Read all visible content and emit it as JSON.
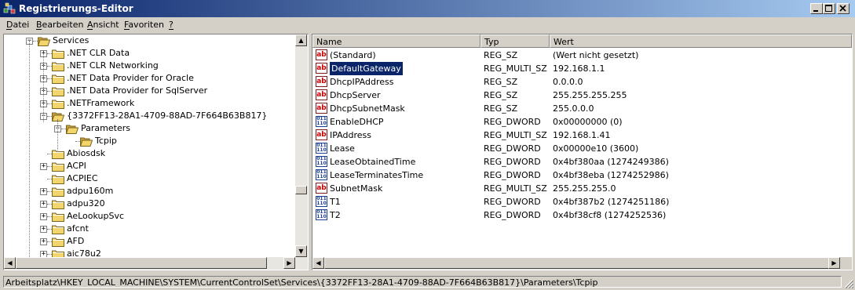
{
  "window": {
    "title": "Registrierungs-Editor",
    "controls": [
      "minimize-icon",
      "maximize-icon",
      "close-icon"
    ]
  },
  "menu": [
    {
      "label": "Datei",
      "accel": "D"
    },
    {
      "label": "Bearbeiten",
      "accel": "B"
    },
    {
      "label": "Ansicht",
      "accel": "A"
    },
    {
      "label": "Favoriten",
      "accel": "F"
    },
    {
      "label": "?",
      "accel": "?"
    }
  ],
  "tree": {
    "items": [
      {
        "label": "Services",
        "expander": "−",
        "icon": "folder-open-icon"
      },
      {
        "label": ".NET CLR Data",
        "expander": "+",
        "icon": "folder-icon"
      },
      {
        "label": ".NET CLR Networking",
        "expander": "+",
        "icon": "folder-icon"
      },
      {
        "label": ".NET Data Provider for Oracle",
        "expander": "+",
        "icon": "folder-icon"
      },
      {
        "label": ".NET Data Provider for SqlServer",
        "expander": "+",
        "icon": "folder-icon"
      },
      {
        "label": ".NETFramework",
        "expander": "+",
        "icon": "folder-icon"
      },
      {
        "label": "{3372FF13-28A1-4709-88AD-7F664B63B817}",
        "expander": "−",
        "icon": "folder-open-icon"
      },
      {
        "label": "Parameters",
        "expander": "−",
        "icon": "folder-open-icon"
      },
      {
        "label": "Tcpip",
        "expander": "",
        "icon": "folder-open-icon"
      },
      {
        "label": "Abiosdsk",
        "expander": "",
        "icon": "folder-icon"
      },
      {
        "label": "ACPI",
        "expander": "+",
        "icon": "folder-icon"
      },
      {
        "label": "ACPIEC",
        "expander": "",
        "icon": "folder-icon"
      },
      {
        "label": "adpu160m",
        "expander": "+",
        "icon": "folder-icon"
      },
      {
        "label": "adpu320",
        "expander": "+",
        "icon": "folder-icon"
      },
      {
        "label": "AeLookupSvc",
        "expander": "+",
        "icon": "folder-icon"
      },
      {
        "label": "afcnt",
        "expander": "+",
        "icon": "folder-icon"
      },
      {
        "label": "AFD",
        "expander": "+",
        "icon": "folder-icon"
      },
      {
        "label": "aic78u2",
        "expander": "+",
        "icon": "folder-icon"
      }
    ]
  },
  "list": {
    "columns": [
      "Name",
      "Typ",
      "Wert"
    ],
    "rows": [
      {
        "name": "(Standard)",
        "type": "REG_SZ",
        "value": "(Wert nicht gesetzt)",
        "icon": "string-value-icon",
        "selected": false
      },
      {
        "name": "DefaultGateway",
        "type": "REG_MULTI_SZ",
        "value": "192.168.1.1",
        "icon": "string-value-icon",
        "selected": true
      },
      {
        "name": "DhcpIPAddress",
        "type": "REG_SZ",
        "value": "0.0.0.0",
        "icon": "string-value-icon",
        "selected": false
      },
      {
        "name": "DhcpServer",
        "type": "REG_SZ",
        "value": "255.255.255.255",
        "icon": "string-value-icon",
        "selected": false
      },
      {
        "name": "DhcpSubnetMask",
        "type": "REG_SZ",
        "value": "255.0.0.0",
        "icon": "string-value-icon",
        "selected": false
      },
      {
        "name": "EnableDHCP",
        "type": "REG_DWORD",
        "value": "0x00000000 (0)",
        "icon": "binary-value-icon",
        "selected": false
      },
      {
        "name": "IPAddress",
        "type": "REG_MULTI_SZ",
        "value": "192.168.1.41",
        "icon": "string-value-icon",
        "selected": false
      },
      {
        "name": "Lease",
        "type": "REG_DWORD",
        "value": "0x00000e10 (3600)",
        "icon": "binary-value-icon",
        "selected": false
      },
      {
        "name": "LeaseObtainedTime",
        "type": "REG_DWORD",
        "value": "0x4bf380aa (1274249386)",
        "icon": "binary-value-icon",
        "selected": false
      },
      {
        "name": "LeaseTerminatesTime",
        "type": "REG_DWORD",
        "value": "0x4bf38eba (1274252986)",
        "icon": "binary-value-icon",
        "selected": false
      },
      {
        "name": "SubnetMask",
        "type": "REG_MULTI_SZ",
        "value": "255.255.255.0",
        "icon": "string-value-icon",
        "selected": false
      },
      {
        "name": "T1",
        "type": "REG_DWORD",
        "value": "0x4bf387b2 (1274251186)",
        "icon": "binary-value-icon",
        "selected": false
      },
      {
        "name": "T2",
        "type": "REG_DWORD",
        "value": "0x4bf38cf8 (1274252536)",
        "icon": "binary-value-icon",
        "selected": false
      }
    ]
  },
  "statusbar": {
    "path": "Arbeitsplatz\\HKEY_LOCAL_MACHINE\\SYSTEM\\CurrentControlSet\\Services\\{3372FF13-28A1-4709-88AD-7F664B63B817}\\Parameters\\Tcpip"
  },
  "colors": {
    "titlebar_start": "#0a246a",
    "titlebar_end": "#a6caf0",
    "selection": "#0a246a",
    "folder": "#f2d56b"
  }
}
